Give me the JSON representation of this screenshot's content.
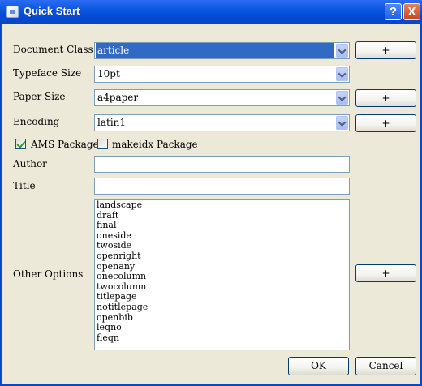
{
  "window": {
    "title": "Quick Start",
    "help_label": "?",
    "close_label": "X"
  },
  "form": {
    "document_class": {
      "label": "Document Class",
      "value": "article",
      "button_label": "+"
    },
    "typeface_size": {
      "label": "Typeface Size",
      "value": "10pt"
    },
    "paper_size": {
      "label": "Paper Size",
      "value": "a4paper",
      "button_label": "+"
    },
    "encoding": {
      "label": "Encoding",
      "value": "latin1",
      "button_label": "+"
    },
    "ams_packages": {
      "label": "AMS Packages",
      "checked": true
    },
    "makeidx_package": {
      "label": "makeidx Package",
      "checked": false
    },
    "author": {
      "label": "Author",
      "value": ""
    },
    "title": {
      "label": "Title",
      "value": ""
    },
    "other_options": {
      "label": "Other Options",
      "button_label": "+",
      "items": [
        "landscape",
        "draft",
        "final",
        "oneside",
        "twoside",
        "openright",
        "openany",
        "onecolumn",
        "twocolumn",
        "titlepage",
        "notitlepage",
        "openbib",
        "leqno",
        "fleqn"
      ]
    }
  },
  "footer": {
    "ok_label": "OK",
    "cancel_label": "Cancel"
  }
}
